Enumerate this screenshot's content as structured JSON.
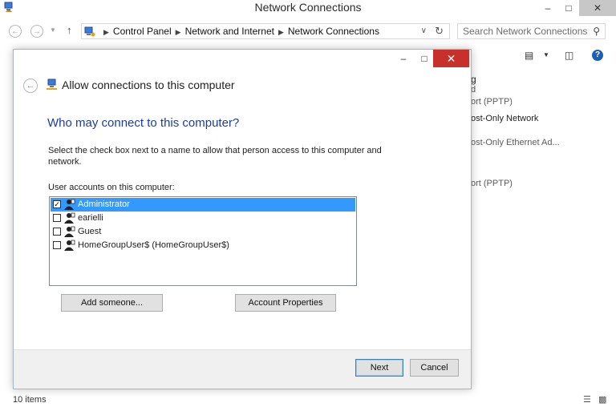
{
  "window": {
    "title": "Network Connections",
    "minimize_glyph": "‒",
    "maximize_glyph": "□",
    "close_glyph": "✕"
  },
  "address_bar": {
    "breadcrumbs": [
      "Control Panel",
      "Network and Internet",
      "Network Connections"
    ],
    "search_placeholder": "Search Network Connections"
  },
  "background_items": [
    "g",
    "d",
    "ort (PPTP)",
    "ost-Only Network",
    "ost-Only Ethernet Ad...",
    "ort (PPTP)"
  ],
  "status_bar": {
    "item_count": "10 items"
  },
  "dialog": {
    "title": "Allow connections to this computer",
    "heading": "Who may connect to this computer?",
    "description": "Select the check box next to a name to allow that person access to this computer and network.",
    "list_label": "User accounts on this computer:",
    "users": [
      {
        "name": "Administrator",
        "checked": true,
        "selected": true
      },
      {
        "name": "earielli",
        "checked": false,
        "selected": false
      },
      {
        "name": "Guest",
        "checked": false,
        "selected": false
      },
      {
        "name": "HomeGroupUser$ (HomeGroupUser$)",
        "checked": false,
        "selected": false
      }
    ],
    "add_button": "Add someone...",
    "properties_button": "Account Properties",
    "next_button": "Next",
    "cancel_button": "Cancel"
  },
  "colors": {
    "heading": "#1c3d9c",
    "selection": "#3399ff",
    "close_red": "#c7302b"
  }
}
